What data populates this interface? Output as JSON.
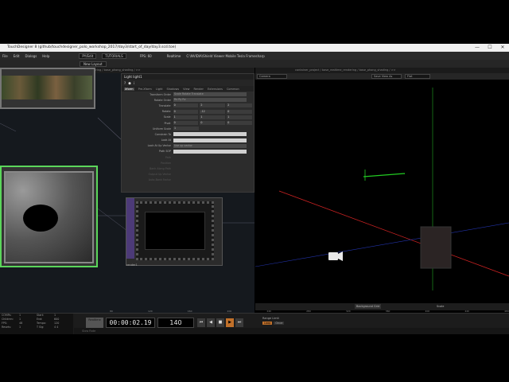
{
  "window": {
    "title": "TouchDesigner 8 (github/touchdesigner_polo_workshop_2017/day3/start_of_day/day3.scd.toe)",
    "controls": [
      "—",
      "☐",
      "✕"
    ]
  },
  "menu": {
    "items": [
      "File",
      "Edit",
      "Dialogs",
      "Help"
    ],
    "fields": [
      "PY/Edit",
      "TUTORIALS"
    ],
    "fps_label": "FPS: 60",
    "realtime_label": "Realtime",
    "gpu_info": "C:\\NVIDIA\\Shield Viewer Mobile Tesla Framesharp"
  },
  "toolbar": {
    "new_layout": "New Layout"
  },
  "network": {
    "path": "container_project / base_realtime_rendering / base_phong_shading / >>",
    "render_node_name": "render1"
  },
  "param": {
    "header": "Light  light1",
    "tabs": [
      "Xform",
      "Pre-Xform",
      "Light",
      "Shadows",
      "View",
      "Render",
      "Extensions",
      "Common"
    ],
    "rows": [
      {
        "label": "Transform Order",
        "v1": "Scale Rotate Translate",
        "wide": true
      },
      {
        "label": "Rotate Order",
        "v1": "Rx Ry Rz",
        "wide": true
      },
      {
        "label": "Translate",
        "v1": "0",
        "v2": "2",
        "v3": "2"
      },
      {
        "label": "Rotate",
        "v1": "0",
        "v2": "-12",
        "v3": "0"
      },
      {
        "label": "Scale",
        "v1": "1",
        "v2": "1",
        "v3": "1"
      },
      {
        "label": "Pivot",
        "v1": "0",
        "v2": "0",
        "v3": "0"
      },
      {
        "label": "Uniform Scale",
        "v1": "1",
        "wide": false,
        "single": true
      },
      {
        "label": "Constrain To",
        "v1": "",
        "light": true
      },
      {
        "label": "Look At",
        "v1": "",
        "light": true
      },
      {
        "label": "Look At Up Vector",
        "v1": "Use up vector",
        "wide": true
      },
      {
        "label": "Path SOP",
        "v1": "",
        "light": true
      },
      {
        "label": "Path",
        "dim": true
      },
      {
        "label": "Position",
        "dim": true
      },
      {
        "label": "Bank Along Path",
        "dim": true
      },
      {
        "label": "Output Up Vector",
        "dim": true
      },
      {
        "label": "Auto-Bank Factor",
        "dim": true
      }
    ]
  },
  "viewport": {
    "path": "container_project / base_realtime_rendering / base_phong_shading / >>",
    "camera_label": "Camera",
    "view_dropdown": "Save View As",
    "flat_dropdown": "Flat",
    "background_label": "Background Grid",
    "scale_label": "Scale"
  },
  "timeline": {
    "timecode": "00:00:02.19",
    "frame": "140",
    "realtime_button": "Realtime",
    "range_label": "Range Limit",
    "range_buttons": [
      "Loop",
      "Once"
    ],
    "controls": [
      "⏮",
      "◀",
      "■",
      "▶",
      "⏭"
    ],
    "bottom": "Slow Rate",
    "ticks": [
      "",
      "80",
      "120",
      "160",
      "200",
      "240",
      "280",
      "320",
      "360",
      "400",
      "440",
      "480"
    ]
  },
  "info": [
    [
      "COMPs:",
      "1",
      "Start:",
      "1"
    ],
    [
      "Children:",
      "1",
      "End:",
      "600"
    ],
    [
      "FPS:",
      "48",
      "Tempo:",
      "120"
    ],
    [
      "Resets:",
      "1",
      "T Sig:",
      "4  4"
    ]
  ],
  "colors": {
    "selected_node": "#5bd65b",
    "accent_orange": "#c0702a",
    "axis_red": "#cc2222",
    "axis_green": "#22cc22",
    "axis_blue": "#2233aa",
    "render_side": "#4c3a78"
  }
}
